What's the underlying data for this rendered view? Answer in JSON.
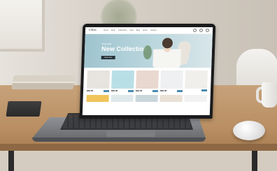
{
  "site": {
    "logo_text": "Oilas",
    "nav_items": [
      "Home",
      "Shop",
      "Collections",
      "Sale",
      "Blog",
      "About",
      "Contact"
    ],
    "hero": {
      "kicker": "Shop Now",
      "title": "New Collection",
      "button_label": "Shop Now"
    },
    "products": [
      {
        "price": "$56.00",
        "color": "#e7e3de"
      },
      {
        "price": "$56.00",
        "color": "#b9dfe6"
      },
      {
        "price": "$56.00",
        "color": "#e9d8cf"
      },
      {
        "price": "$56.00",
        "color": "#eef0f1"
      },
      {
        "price": "",
        "color": "#f1efec"
      }
    ],
    "products_row2": [
      {
        "color": "#f0c45a"
      },
      {
        "color": "#dfe8ea"
      },
      {
        "color": "#c9d7db"
      },
      {
        "color": "#e9e0d6"
      },
      {
        "color": "#f2f2f2"
      }
    ]
  },
  "scene": {
    "accent_blue": "#9fc4cf",
    "wood": "#b98f63"
  }
}
